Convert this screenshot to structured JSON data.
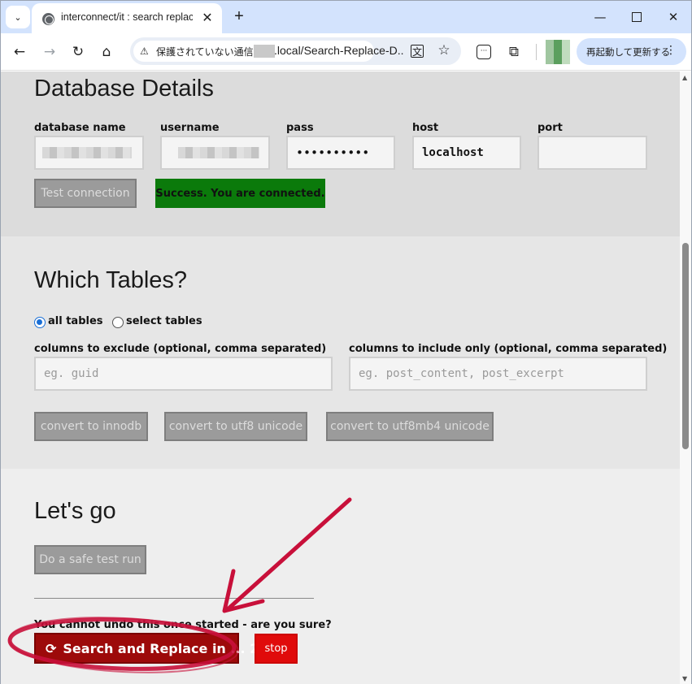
{
  "browser": {
    "tab_title": "interconnect/it : search replace",
    "tab_menu_icon": "chevron-down-icon",
    "security_text": "保護されていない通信",
    "url": ".local/Search-Replace-D...",
    "update_button": "再起動して更新する"
  },
  "db": {
    "heading": "Database Details",
    "labels": {
      "name": "database name",
      "user": "username",
      "pass": "pass",
      "host": "host",
      "port": "port"
    },
    "values": {
      "pass": "••••••••••",
      "host": "localhost",
      "port": ""
    },
    "test_button": "Test connection",
    "success_message": "Success. You are connected."
  },
  "tables": {
    "heading": "Which Tables?",
    "radio_all": "all tables",
    "radio_select": "select tables",
    "exclude_label": "columns to exclude (optional, comma separated)",
    "exclude_placeholder": "eg. guid",
    "include_label": "columns to include only (optional, comma separated)",
    "include_placeholder": "eg. post_content, post_excerpt",
    "btn_innodb": "convert to innodb",
    "btn_utf8": "convert to utf8 unicode",
    "btn_utf8mb4": "convert to utf8mb4 unicode"
  },
  "go": {
    "heading": "Let's go",
    "dry_run_button": "Do a safe test run",
    "warning": "You cannot undo this once started - are you sure?",
    "run_button": "Search and Replace in ... 2",
    "stop_button": "stop"
  },
  "colors": {
    "success": "#0b7a0b",
    "danger": "#9d0a0a",
    "stop": "#e00b0b",
    "annotation": "#c8103a"
  }
}
